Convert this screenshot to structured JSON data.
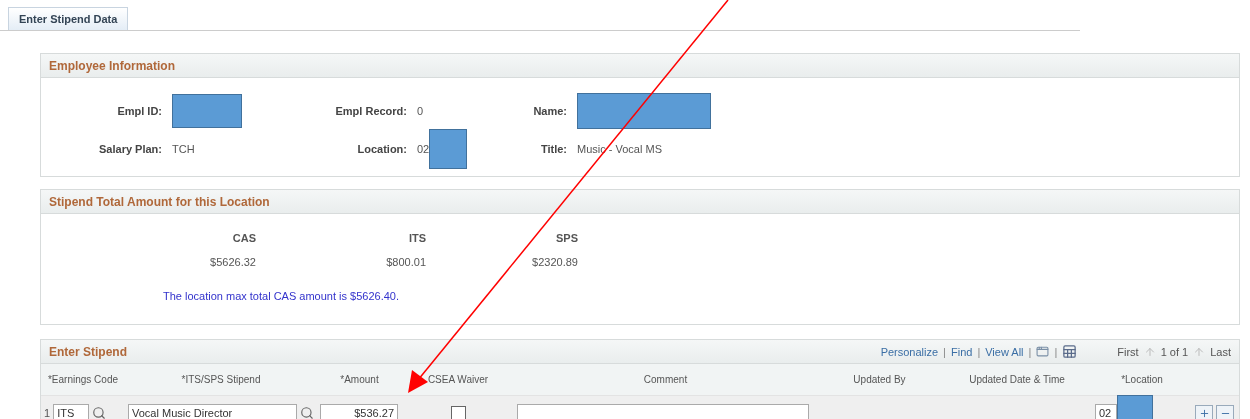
{
  "tab": {
    "label": "Enter Stipend Data",
    "selected": true
  },
  "employee_info": {
    "title": "Employee Information",
    "fields": [
      {
        "label": "Empl ID:",
        "redacted": true
      },
      {
        "label": "Empl Record:",
        "value": "0",
        "redacted": false
      },
      {
        "label": "Name:",
        "redacted": true
      },
      {
        "label": "Salary Plan:",
        "value": "TCH",
        "redacted": false
      },
      {
        "label": "Location:",
        "value": "02",
        "redacted": true
      },
      {
        "label": "Title:",
        "value": "Music - Vocal MS",
        "redacted": false
      }
    ]
  },
  "totals": {
    "title": "Stipend Total Amount for this Location",
    "columns": [
      {
        "heading": "CAS",
        "amount": "$5626.32"
      },
      {
        "heading": "ITS",
        "amount": "$800.01"
      },
      {
        "heading": "SPS",
        "amount": "$2320.89"
      }
    ],
    "message": "The location max total CAS amount is $5626.40."
  },
  "grid": {
    "title": "Enter Stipend",
    "toolbar": [
      {
        "kind": "link",
        "text": "Personalize"
      },
      {
        "kind": "separator",
        "text": "|"
      },
      {
        "kind": "link",
        "text": "Find"
      },
      {
        "kind": "separator",
        "text": "|"
      },
      {
        "kind": "link",
        "text": "View All"
      },
      {
        "kind": "separator",
        "text": "|"
      },
      {
        "kind": "window"
      },
      {
        "kind": "separator",
        "text": "|"
      },
      {
        "kind": "sheet"
      }
    ],
    "nav": {
      "first": "First",
      "position": "1 of 1",
      "last": "Last"
    },
    "columns": [
      "*Earnings Code",
      "*ITS/SPS Stipend",
      "*Amount",
      "CSEA Waiver",
      "Comment",
      "Updated By",
      "Updated Date & Time",
      "*Location"
    ],
    "rows": [
      {
        "number": "1",
        "earnings_code": "ITS",
        "stipend": "Vocal Music Director",
        "amount": "$536.27",
        "csea_waiver": false,
        "location": "02",
        "location_redacted": true
      }
    ]
  }
}
